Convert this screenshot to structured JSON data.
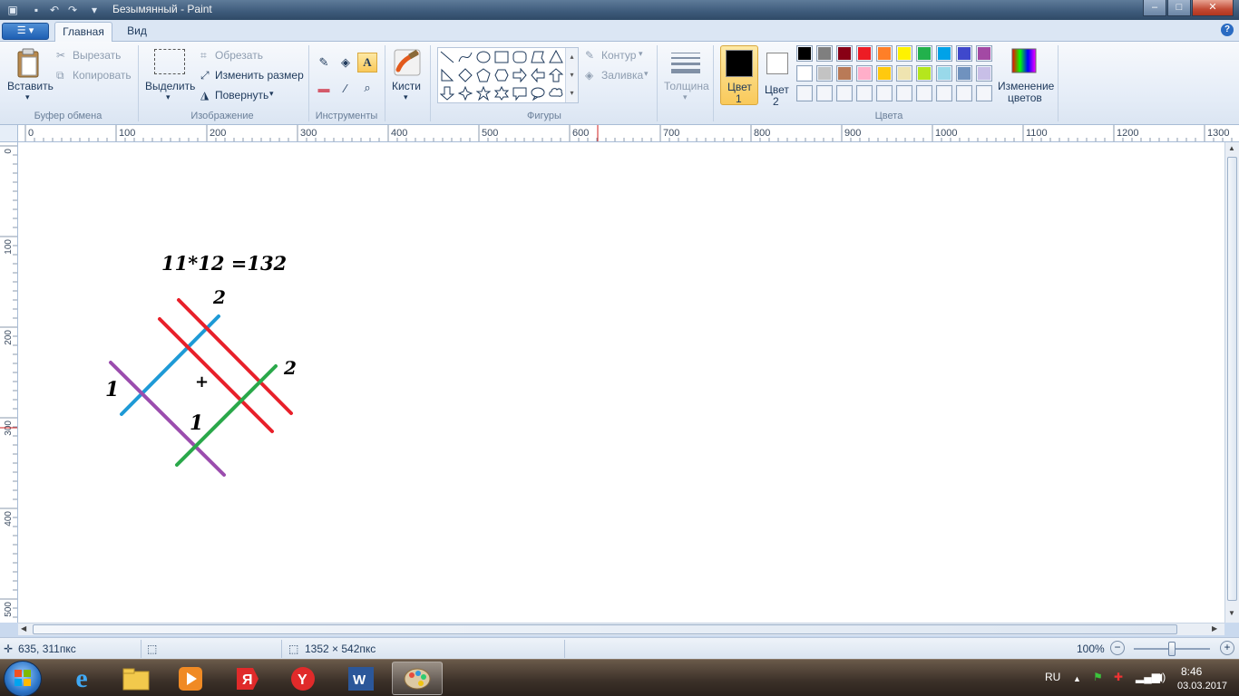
{
  "window": {
    "title": "Безымянный - Paint",
    "buttons": {
      "minimize": "–",
      "maximize": "□",
      "close": "✕"
    }
  },
  "tabs": {
    "menu": "▾",
    "home": "Главная",
    "view": "Вид"
  },
  "ribbon": {
    "clipboard": {
      "paste": "Вставить",
      "cut": "Вырезать",
      "copy": "Копировать",
      "label": "Буфер обмена"
    },
    "image": {
      "select": "Выделить",
      "crop": "Обрезать",
      "resize": "Изменить размер",
      "rotate": "Повернуть",
      "label": "Изображение"
    },
    "tools": {
      "label": "Инструменты"
    },
    "brushes": {
      "label": "Кисти"
    },
    "shapes": {
      "outline": "Контур",
      "fill": "Заливка",
      "label": "Фигуры"
    },
    "size": {
      "label": "Толщина"
    },
    "colors": {
      "color1_a": "Цвет",
      "color1_b": "1",
      "color2_a": "Цвет",
      "color2_b": "2",
      "edit_a": "Изменение",
      "edit_b": "цветов",
      "label": "Цвета",
      "color1_value": "#000000",
      "color2_value": "#ffffff",
      "palette_row1": [
        "#000000",
        "#7f7f7f",
        "#880015",
        "#ed1c24",
        "#ff7f27",
        "#fff200",
        "#22b14c",
        "#00a2e8",
        "#3f48cc",
        "#a349a4"
      ],
      "palette_row2": [
        "#ffffff",
        "#c3c3c3",
        "#b97a57",
        "#ffaec9",
        "#ffc90e",
        "#efe4b0",
        "#b5e61d",
        "#99d9ea",
        "#7092be",
        "#c8bfe7"
      ],
      "palette_row3": [
        "",
        "",
        "",
        "",
        "",
        "",
        "",
        "",
        "",
        ""
      ]
    }
  },
  "ruler": {
    "top": [
      "0",
      "100",
      "200",
      "300",
      "400",
      "500",
      "600",
      "700",
      "800",
      "900",
      "1000",
      "1100",
      "1200",
      "1300"
    ],
    "left": [
      "0",
      "100",
      "200",
      "300",
      "400",
      "500"
    ]
  },
  "drawing": {
    "equation": "11*12 =132",
    "label_top_right": "2",
    "label_right": "2",
    "label_left": "1",
    "label_center_plus": "+",
    "label_center_bottom": "1",
    "colors": {
      "blue": "#1e9ad6",
      "red": "#e8202a",
      "purple": "#9b4dae",
      "green": "#2aa84a"
    }
  },
  "status": {
    "cursor_pos": "635, 311пкс",
    "canvas_size": "1352 × 542пкс",
    "zoom": "100%"
  },
  "taskbar": {
    "apps": [
      "internet-explorer",
      "file-explorer",
      "media-player",
      "yandex",
      "yandex-browser",
      "word",
      "paint"
    ],
    "language": "RU",
    "time": "8:46",
    "date": "03.03.2017"
  }
}
